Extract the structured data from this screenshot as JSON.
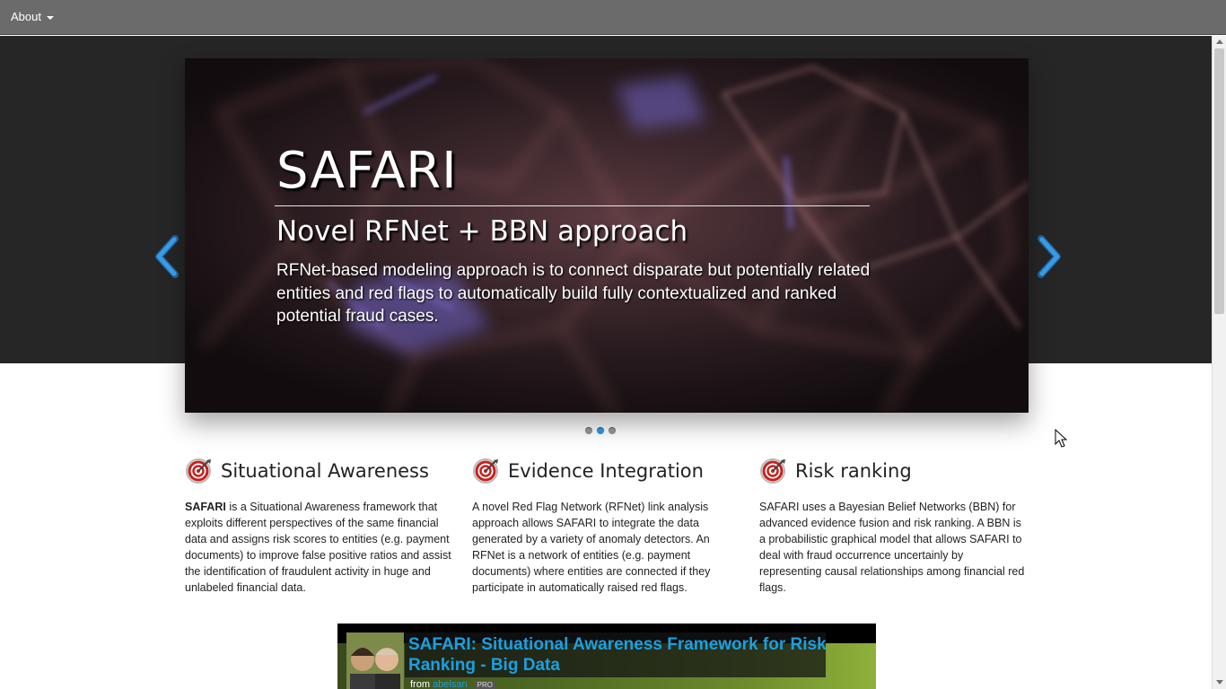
{
  "nav": {
    "about_label": "About"
  },
  "carousel": {
    "title": "SAFARI",
    "subtitle": "Novel RFNet + BBN approach",
    "text": "RFNet-based modeling approach is to connect disparate but potentially related entities and red flags to automatically build fully contextualized and ranked potential fraud cases.",
    "dot_count": 3,
    "active_index": 1,
    "arrow_color": "#2a8ad6"
  },
  "features": [
    {
      "icon": "target-icon",
      "title": "Situational Awareness",
      "lead": "SAFARI",
      "text": " is a Situational Awareness framework that exploits different perspectives of the same financial data and assigns risk scores to entities (e.g. payment documents) to improve false positive ratios and assist the identification of fraudulent activity in huge and unlabeled financial data."
    },
    {
      "icon": "target-icon",
      "title": "Evidence Integration",
      "text": "A novel Red Flag Network (RFNet) link analysis approach allows SAFARI to integrate the data generated by a variety of anomaly detectors. An RFNet is a network of entities (e.g. payment documents) where entities are connected if they participate in automatically raised red flags."
    },
    {
      "icon": "target-icon",
      "title": "Risk ranking",
      "text": "SAFARI uses a Bayesian Belief Networks (BBN) for advanced evidence fusion and risk ranking. A BBN is a probabilistic graphical model that allows SAFARI to deal with fraud occurrence uncertainly by representing causal relationships among financial red flags."
    }
  ],
  "video": {
    "title": "SAFARI: Situational Awareness Framework for Risk Ranking - Big Data",
    "from_label": "from",
    "user": "abelsan",
    "badge": "PRO"
  },
  "colors": {
    "band": "#262626",
    "navbar": "#6b6b6b",
    "accent": "#2a8ad6",
    "video_title": "#1aa0e3"
  }
}
